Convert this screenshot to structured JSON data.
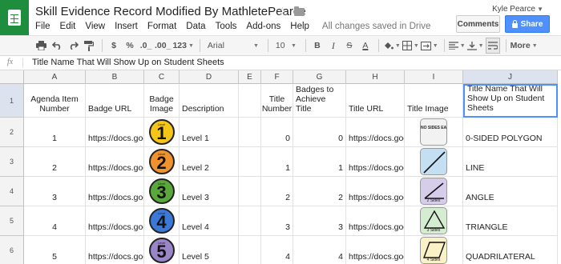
{
  "app": {
    "title": "Skill Evidence Record Modified By MathletePearce",
    "save_status": "All changes saved in Drive",
    "user": "Kyle Pearce",
    "comments_label": "Comments",
    "share_label": "Share"
  },
  "menu": [
    "File",
    "Edit",
    "View",
    "Insert",
    "Format",
    "Data",
    "Tools",
    "Add-ons",
    "Help"
  ],
  "toolbar": {
    "currency": "$",
    "percent": "%",
    "dec_less": ".0_",
    "dec_more": ".00_",
    "number_format": "123",
    "font": "Arial",
    "font_size": "10",
    "bold": "B",
    "italic": "I",
    "strike": "S",
    "text_color": "A",
    "more": "More"
  },
  "formula_bar": {
    "fx": "fx",
    "content": "Title Name That Will Show Up on Student Sheets"
  },
  "columns": [
    "A",
    "B",
    "C",
    "D",
    "E",
    "F",
    "G",
    "H",
    "I",
    "J"
  ],
  "headers": {
    "a": "Agenda Item Number",
    "b": "Badge URL",
    "c": "Badge Image",
    "d": "Description",
    "e": "",
    "f": "Title Number",
    "g": "Number of Badges to Achieve Title",
    "h": "Title URL",
    "i": "Title Image",
    "j": "Title Name That Will Show Up on Student Sheets"
  },
  "row_numbers": [
    "1",
    "2",
    "3",
    "4",
    "5",
    "6"
  ],
  "rows": [
    {
      "a": "1",
      "b": "https://docs.goog",
      "badge_num": "1",
      "badge_color": "#f5c518",
      "d": "Level 1",
      "f": "0",
      "g": "0",
      "h": "https://docs.goog",
      "title_bg": "#f2f2f2",
      "title_shape": "none",
      "title_text": "NO SIDES EARNED YET",
      "title_sides": "",
      "j": "0-SIDED POLYGON"
    },
    {
      "a": "2",
      "b": "https://docs.goog",
      "badge_num": "2",
      "badge_color": "#f0922e",
      "d": "Level 2",
      "f": "1",
      "g": "1",
      "h": "https://docs.goog",
      "title_bg": "#c5dff2",
      "title_shape": "line",
      "title_text": "",
      "title_sides": "",
      "j": "LINE"
    },
    {
      "a": "3",
      "b": "https://docs.goog",
      "badge_num": "3",
      "badge_color": "#5aa83c",
      "d": "Level 3",
      "f": "2",
      "g": "2",
      "h": "https://docs.goog",
      "title_bg": "#d6cdea",
      "title_shape": "angle",
      "title_text": "",
      "title_sides": "2 Sides",
      "j": "ANGLE"
    },
    {
      "a": "4",
      "b": "https://docs.goog",
      "badge_num": "4",
      "badge_color": "#3b78d8",
      "d": "Level 4",
      "f": "3",
      "g": "3",
      "h": "https://docs.goog",
      "title_bg": "#d4ecd0",
      "title_shape": "triangle",
      "title_text": "",
      "title_sides": "3 Sides",
      "j": "TRIANGLE"
    },
    {
      "a": "5",
      "b": "https://docs.goog",
      "badge_num": "5",
      "badge_color": "#9b85c9",
      "d": "Level 5",
      "f": "4",
      "g": "4",
      "h": "https://docs.goog",
      "title_bg": "#fbf1c7",
      "title_shape": "quad",
      "title_text": "",
      "title_sides": "4 Sides",
      "j": "QUADRILATERAL"
    }
  ],
  "badge_level_label": "Level"
}
